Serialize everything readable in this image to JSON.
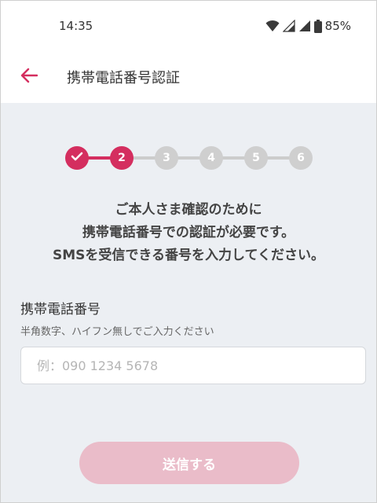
{
  "status_bar": {
    "time": "14:35",
    "battery": "85%",
    "icons": [
      "wifi-icon",
      "signal-icon",
      "signal-icon",
      "battery-icon"
    ]
  },
  "app_bar": {
    "title": "携帯電話番号認証",
    "back_icon": "arrow-left-icon"
  },
  "stepper": {
    "current_step": 2,
    "total_steps": 6,
    "steps": [
      {
        "label": "",
        "state": "done"
      },
      {
        "label": "2",
        "state": "active"
      },
      {
        "label": "3",
        "state": "pending"
      },
      {
        "label": "4",
        "state": "pending"
      },
      {
        "label": "5",
        "state": "pending"
      },
      {
        "label": "6",
        "state": "pending"
      }
    ]
  },
  "message": {
    "line1": "ご本人さま確認のために",
    "line2": "携帯電話番号での認証が必要です。",
    "line3": "SMSを受信できる番号を入力してください。"
  },
  "form": {
    "label": "携帯電話番号",
    "hint": "半角数字、ハイフン無しでご入力ください",
    "placeholder": "例：090 1234 5678",
    "value": ""
  },
  "submit": {
    "label": "送信する",
    "enabled": false
  },
  "colors": {
    "accent": "#d42e5f",
    "accent_disabled": "#eabcc9",
    "step_pending": "#cfcfcf",
    "background": "#eceff3"
  }
}
